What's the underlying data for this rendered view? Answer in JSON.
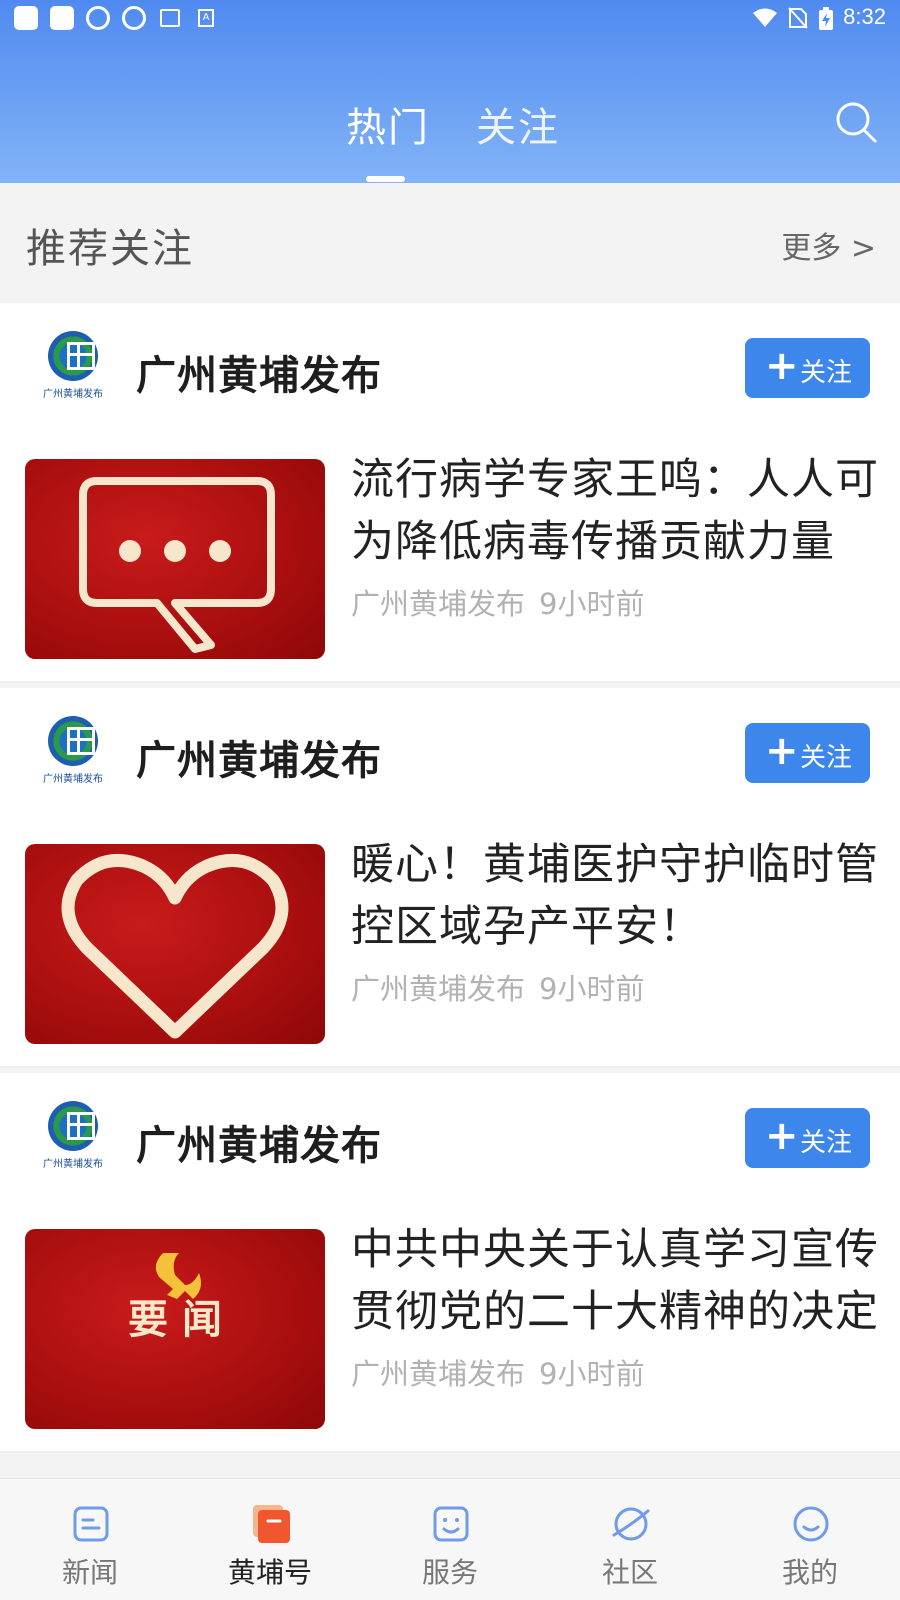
{
  "status_bar": {
    "time": "8:32",
    "left_icons": [
      "app-square-icon",
      "app-square-icon",
      "globe-icon",
      "globe-icon",
      "image-icon",
      "text-a-icon"
    ],
    "right_icons": [
      "wifi-icon",
      "no-sim-icon",
      "battery-charging-icon"
    ]
  },
  "header": {
    "tabs": [
      {
        "label": "热门",
        "active": true
      },
      {
        "label": "关注",
        "active": false
      }
    ],
    "search_icon": "search-icon",
    "gradient": [
      "#4f8af0",
      "#83b3f7"
    ]
  },
  "recommend": {
    "title": "推荐关注",
    "more": "更多 >"
  },
  "cards": [
    {
      "source": "广州黄埔发布",
      "logo_caption": "广州黄埔发布",
      "follow_label": "关注",
      "headline": "流行病学专家王鸣：人人可为降低病毒传播贡献力量",
      "meta_source": "广州黄埔发布",
      "meta_time": "9小时前",
      "thumb": "speech-bubble"
    },
    {
      "source": "广州黄埔发布",
      "logo_caption": "广州黄埔发布",
      "follow_label": "关注",
      "headline": "暖心！黄埔医护守护临时管控区域孕产平安！",
      "meta_source": "广州黄埔发布",
      "meta_time": "9小时前",
      "thumb": "heart"
    },
    {
      "source": "广州黄埔发布",
      "logo_caption": "广州黄埔发布",
      "follow_label": "关注",
      "headline": "中共中央关于认真学习宣传贯彻党的二十大精神的决定",
      "meta_source": "广州黄埔发布",
      "meta_time": "9小时前",
      "thumb": "party-news",
      "thumb_text": "要 闻"
    }
  ],
  "bottom_nav": [
    {
      "label": "新闻",
      "icon": "news-icon",
      "active": false
    },
    {
      "label": "黄埔号",
      "icon": "huangpu-icon",
      "active": true
    },
    {
      "label": "服务",
      "icon": "service-icon",
      "active": false
    },
    {
      "label": "社区",
      "icon": "community-icon",
      "active": false
    },
    {
      "label": "我的",
      "icon": "profile-icon",
      "active": false
    }
  ],
  "colors": {
    "accent": "#3d86ec",
    "thumb_red": "#b01212",
    "meta_gray": "#b2b2b2"
  }
}
